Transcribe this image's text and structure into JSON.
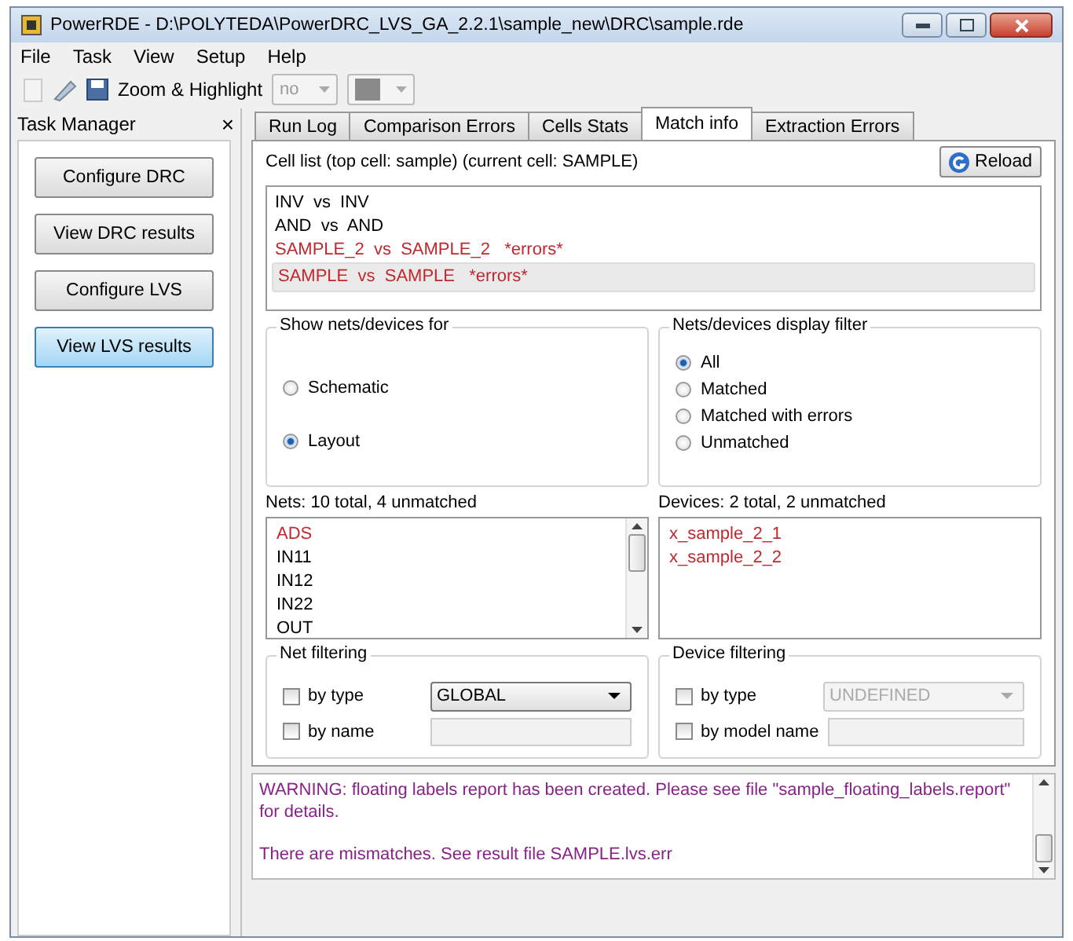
{
  "window": {
    "title": "PowerRDE - D:\\POLYTEDA\\PowerDRC_LVS_GA_2.2.1\\sample_new\\DRC\\sample.rde"
  },
  "menu": [
    "File",
    "Task",
    "View",
    "Setup",
    "Help"
  ],
  "toolbar": {
    "zoom_label": "Zoom & Highlight",
    "zoom_value": "no"
  },
  "task_manager": {
    "title": "Task Manager",
    "close": "×",
    "buttons": [
      {
        "label": "Configure DRC",
        "selected": false
      },
      {
        "label": "View DRC results",
        "selected": false
      },
      {
        "label": "Configure LVS",
        "selected": false
      },
      {
        "label": "View LVS results",
        "selected": true
      }
    ]
  },
  "tabs": [
    {
      "label": "Run Log",
      "selected": false
    },
    {
      "label": "Comparison Errors",
      "selected": false
    },
    {
      "label": "Cells Stats",
      "selected": false
    },
    {
      "label": "Match info",
      "selected": true
    },
    {
      "label": "Extraction Errors",
      "selected": false
    }
  ],
  "cell_list": {
    "label": "Cell list (top cell: sample) (current cell: SAMPLE)",
    "reload_button": "Reload",
    "items": [
      {
        "text": "INV  vs  INV",
        "error": false,
        "selected": false
      },
      {
        "text": "AND  vs  AND",
        "error": false,
        "selected": false
      },
      {
        "text": "SAMPLE_2  vs  SAMPLE_2   *errors*",
        "error": true,
        "selected": false
      },
      {
        "text": "SAMPLE  vs  SAMPLE   *errors*",
        "error": true,
        "selected": true
      }
    ]
  },
  "show_for": {
    "title": "Show nets/devices for",
    "options": [
      {
        "label": "Schematic",
        "selected": false
      },
      {
        "label": "Layout",
        "selected": true
      }
    ]
  },
  "display_filter": {
    "title": "Nets/devices display filter",
    "options": [
      {
        "label": "All",
        "selected": true
      },
      {
        "label": "Matched",
        "selected": false
      },
      {
        "label": "Matched with errors",
        "selected": false
      },
      {
        "label": "Unmatched",
        "selected": false
      }
    ]
  },
  "nets": {
    "label": "Nets: 10 total, 4 unmatched",
    "items": [
      {
        "text": "ADS",
        "error": true
      },
      {
        "text": "IN11",
        "error": false
      },
      {
        "text": "IN12",
        "error": false
      },
      {
        "text": "IN22",
        "error": false
      },
      {
        "text": "OUT",
        "error": false
      }
    ]
  },
  "devices": {
    "label": "Devices: 2 total, 2 unmatched",
    "items": [
      {
        "text": "x_sample_2_1",
        "error": true
      },
      {
        "text": "x_sample_2_2",
        "error": true
      }
    ]
  },
  "net_filtering": {
    "title": "Net filtering",
    "rows": [
      {
        "label": "by type",
        "checked": false,
        "kind": "select",
        "value": "GLOBAL",
        "disabled": false
      },
      {
        "label": "by name",
        "checked": false,
        "kind": "text",
        "disabled": false
      }
    ]
  },
  "device_filtering": {
    "title": "Device filtering",
    "rows": [
      {
        "label": "by type",
        "checked": false,
        "kind": "select",
        "value": "UNDEFINED",
        "disabled": true
      },
      {
        "label": "by model name",
        "checked": false,
        "kind": "text",
        "disabled": false
      }
    ]
  },
  "log": [
    "WARNING: floating labels report has been created. Please see file \"sample_floating_labels.report\" for details.",
    "There are mismatches. See result file SAMPLE.lvs.err"
  ]
}
